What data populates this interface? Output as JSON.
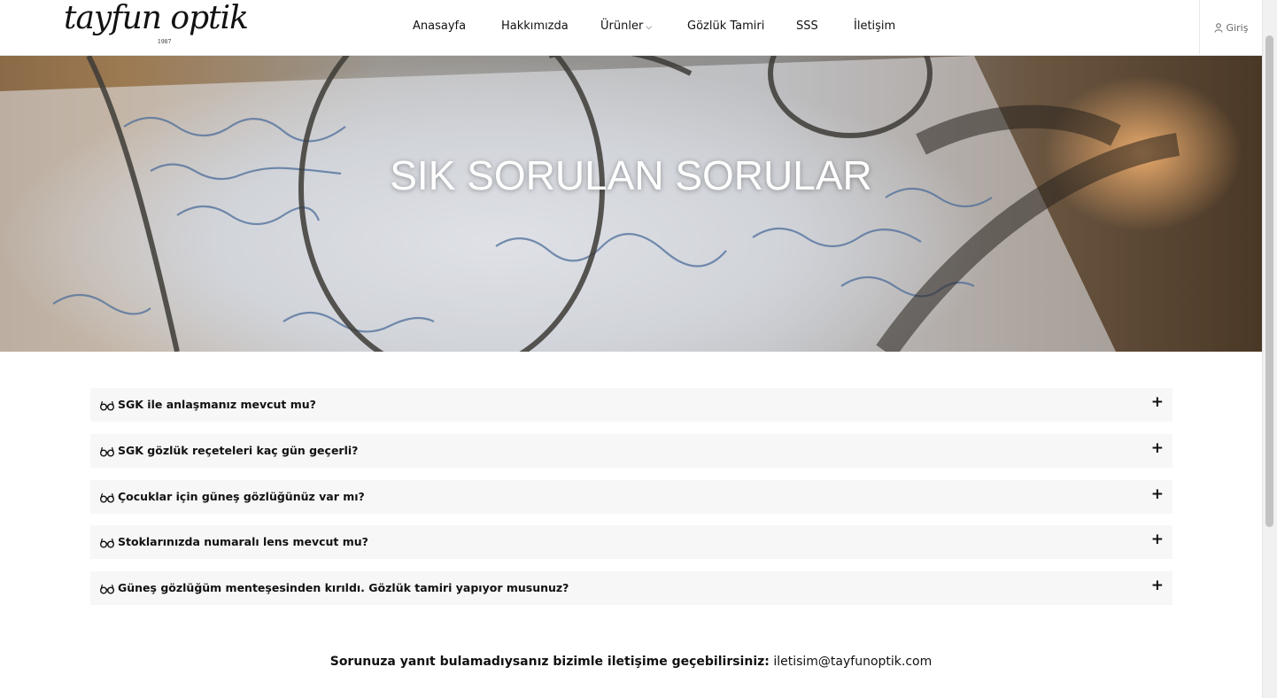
{
  "brand": {
    "logo_text": "tayfun optik",
    "logo_year": "1987"
  },
  "nav": {
    "items": [
      {
        "label": "Anasayfa"
      },
      {
        "label": "Hakkımızda"
      },
      {
        "label": "Ürünler"
      },
      {
        "label": "Gözlük Tamiri"
      },
      {
        "label": "SSS"
      },
      {
        "label": "İletişim"
      }
    ],
    "login_label": "Giriş"
  },
  "hero": {
    "title": "SIK SORULAN SORULAR"
  },
  "faq": {
    "items": [
      {
        "question": "SGK ile anlaşmanız mevcut mu?"
      },
      {
        "question": "SGK gözlük reçeteleri kaç gün geçerli?"
      },
      {
        "question": "Çocuklar için güneş gözlüğünüz var mı?"
      },
      {
        "question": "Stoklarınızda numaralı lens mevcut mu?"
      },
      {
        "question": "Güneş gözlüğüm menteşesinden kırıldı. Gözlük tamiri yapıyor musunuz?"
      }
    ],
    "expand_symbol": "+"
  },
  "contact": {
    "prompt": "Sorunuza yanıt bulamadıysanız bizimle iletişime geçebilirsiniz:",
    "email": "iletisim@tayfunoptik.com"
  },
  "icons": {
    "faq_item": "glasses-icon",
    "expand": "plus-icon",
    "login": "user-icon",
    "dropdown": "chevron-down-icon"
  }
}
